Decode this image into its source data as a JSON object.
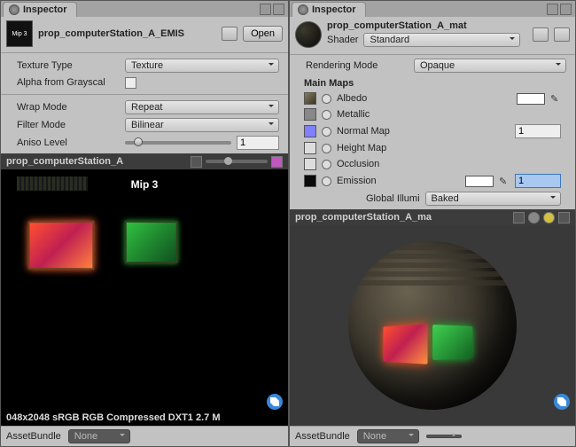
{
  "left": {
    "tab": "Inspector",
    "asset_name": "prop_computerStation_A_EMIS",
    "open_btn": "Open",
    "texture_type": {
      "label": "Texture Type",
      "value": "Texture"
    },
    "alpha_gray": {
      "label": "Alpha from Grayscal"
    },
    "wrap_mode": {
      "label": "Wrap Mode",
      "value": "Repeat"
    },
    "filter_mode": {
      "label": "Filter Mode",
      "value": "Bilinear"
    },
    "aniso": {
      "label": "Aniso Level",
      "value": "1"
    },
    "preview_title": "prop_computerStation_A",
    "mip_label": "Mip 3",
    "footer_info": "048x2048 sRGB  RGB Compressed DXT1   2.7 M",
    "bundle_label": "AssetBundle",
    "bundle_value": "None"
  },
  "right": {
    "tab": "Inspector",
    "asset_name": "prop_computerStation_A_mat",
    "shader": {
      "label": "Shader",
      "value": "Standard"
    },
    "rendering_mode": {
      "label": "Rendering Mode",
      "value": "Opaque"
    },
    "main_maps": "Main Maps",
    "albedo": "Albedo",
    "metallic": "Metallic",
    "normal": "Normal Map",
    "normal_value": "1",
    "height": "Height Map",
    "occlusion": "Occlusion",
    "emission": "Emission",
    "emission_value": "1",
    "global_illum": {
      "label": "Global Illumi",
      "value": "Baked"
    },
    "preview_title": "prop_computerStation_A_ma",
    "bundle_label": "AssetBundle",
    "bundle_value": "None"
  }
}
